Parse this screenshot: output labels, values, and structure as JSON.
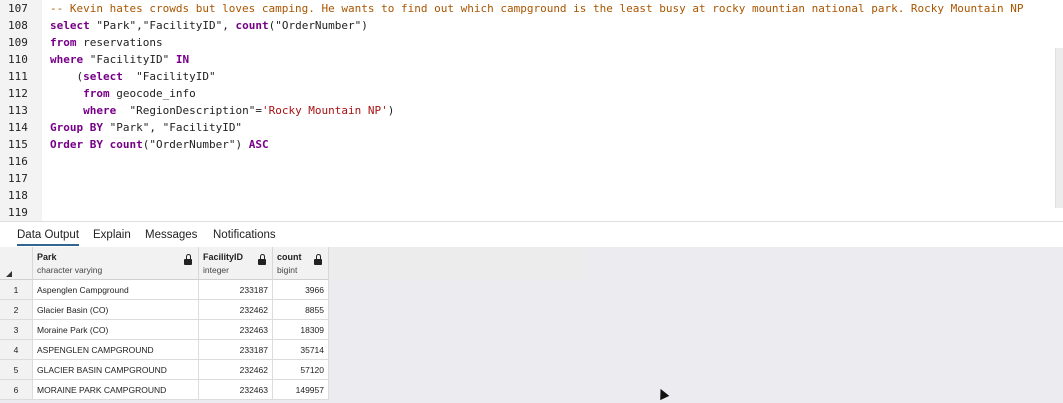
{
  "editor": {
    "lines": [
      {
        "no": "107",
        "parts": [
          {
            "t": "-- Kevin hates crowds but loves camping. He wants to find out which campground is the least busy at rocky mountian national park. Rocky Mountain NP",
            "c": "cm"
          }
        ]
      },
      {
        "no": "108",
        "parts": [
          {
            "t": "select",
            "c": "kw"
          },
          {
            "t": " \"Park\",\"FacilityID\", ",
            "c": "str"
          },
          {
            "t": "count",
            "c": "kw"
          },
          {
            "t": "(\"OrderNumber\")",
            "c": "str"
          }
        ]
      },
      {
        "no": "109",
        "parts": [
          {
            "t": "from",
            "c": "kw"
          },
          {
            "t": " reservations",
            "c": "str"
          }
        ]
      },
      {
        "no": "110",
        "parts": [
          {
            "t": "where",
            "c": "kw"
          },
          {
            "t": " \"FacilityID\" ",
            "c": "str"
          },
          {
            "t": "IN",
            "c": "kw"
          }
        ]
      },
      {
        "no": "111",
        "parts": [
          {
            "t": "    (",
            "c": "str"
          },
          {
            "t": "select",
            "c": "kw"
          },
          {
            "t": "  \"FacilityID\"",
            "c": "str"
          }
        ]
      },
      {
        "no": "112",
        "parts": [
          {
            "t": "     ",
            "c": "str"
          },
          {
            "t": "from",
            "c": "kw"
          },
          {
            "t": " geocode_info",
            "c": "str"
          }
        ]
      },
      {
        "no": "113",
        "parts": [
          {
            "t": "     ",
            "c": "str"
          },
          {
            "t": "where",
            "c": "kw"
          },
          {
            "t": "  \"RegionDescription\"=",
            "c": "str"
          },
          {
            "t": "'Rocky Mountain NP'",
            "c": "sq"
          },
          {
            "t": ")",
            "c": "str"
          }
        ]
      },
      {
        "no": "114",
        "parts": [
          {
            "t": "Group BY",
            "c": "kw"
          },
          {
            "t": " \"Park\", \"FacilityID\"",
            "c": "str"
          }
        ]
      },
      {
        "no": "115",
        "parts": [
          {
            "t": "Order BY",
            "c": "kw"
          },
          {
            "t": " ",
            "c": "str"
          },
          {
            "t": "count",
            "c": "kw"
          },
          {
            "t": "(\"OrderNumber\") ",
            "c": "str"
          },
          {
            "t": "ASC",
            "c": "kw"
          }
        ]
      },
      {
        "no": "116",
        "parts": []
      },
      {
        "no": "117",
        "parts": []
      },
      {
        "no": "118",
        "parts": []
      },
      {
        "no": "119",
        "parts": []
      }
    ]
  },
  "tabs": [
    {
      "label": "Data Output",
      "active": true
    },
    {
      "label": "Explain",
      "active": false
    },
    {
      "label": "Messages",
      "active": false
    },
    {
      "label": "Notifications",
      "active": false
    }
  ],
  "grid": {
    "columns": [
      {
        "name": "Park",
        "type": "character varying"
      },
      {
        "name": "FacilityID",
        "type": "integer"
      },
      {
        "name": "count",
        "type": "bigint"
      }
    ],
    "rows": [
      {
        "n": "1",
        "park": "Aspenglen Campground",
        "facility": "233187",
        "count": "3966"
      },
      {
        "n": "2",
        "park": "Glacier Basin (CO)",
        "facility": "232462",
        "count": "8855"
      },
      {
        "n": "3",
        "park": "Moraine Park (CO)",
        "facility": "232463",
        "count": "18309"
      },
      {
        "n": "4",
        "park": "ASPENGLEN CAMPGROUND",
        "facility": "233187",
        "count": "35714"
      },
      {
        "n": "5",
        "park": "GLACIER BASIN CAMPGROUND",
        "facility": "232462",
        "count": "57120"
      },
      {
        "n": "6",
        "park": "MORAINE PARK CAMPGROUND",
        "facility": "232463",
        "count": "149957"
      }
    ]
  },
  "colors": {
    "keyword": "#770088",
    "comment": "#aa5500",
    "string": "#aa1111",
    "tab_accent": "#326690"
  },
  "icons": {
    "column_lock": "lock-icon",
    "sort_corner": "select-all-corner-icon",
    "cursor": "mouse-pointer-icon"
  }
}
